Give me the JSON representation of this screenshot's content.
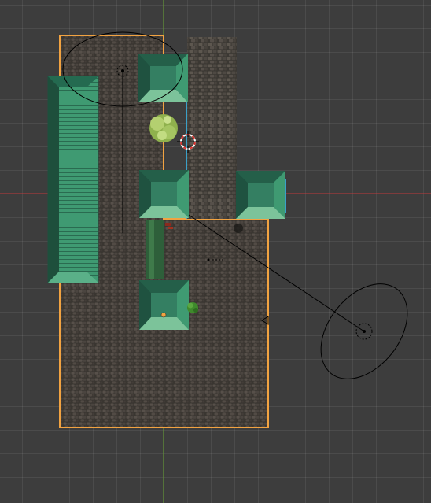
{
  "viewport": {
    "mode": "top-orthographic",
    "background": "#3d3d3d",
    "grid_color": "#4a4a4a",
    "x_axis_color": "#c0393c",
    "y_axis_color": "#6aa636",
    "selection_color": "#f2a341",
    "active_edge_color": "#3aa0c8"
  },
  "scene": {
    "objects": [
      {
        "name": "cobblestone-ground",
        "selected": true
      },
      {
        "name": "cobblestone-path",
        "selected": false
      },
      {
        "name": "long-roof-house",
        "selected": false
      },
      {
        "name": "house-roof-1",
        "selected": false
      },
      {
        "name": "house-roof-2",
        "selected": false
      },
      {
        "name": "house-roof-3",
        "selected": false
      },
      {
        "name": "house-roof-4",
        "selected": false
      },
      {
        "name": "tree",
        "selected": false
      },
      {
        "name": "bush",
        "selected": false
      },
      {
        "name": "light-1",
        "selected": false
      },
      {
        "name": "light-2",
        "selected": false
      },
      {
        "name": "camera",
        "selected": false
      },
      {
        "name": "3d-cursor",
        "selected": false
      }
    ],
    "roof_color": "#2f7a5e",
    "roof_highlight": "#7cc39a",
    "tree_color": "#a7c760",
    "bush_color": "#3f8a2c"
  }
}
